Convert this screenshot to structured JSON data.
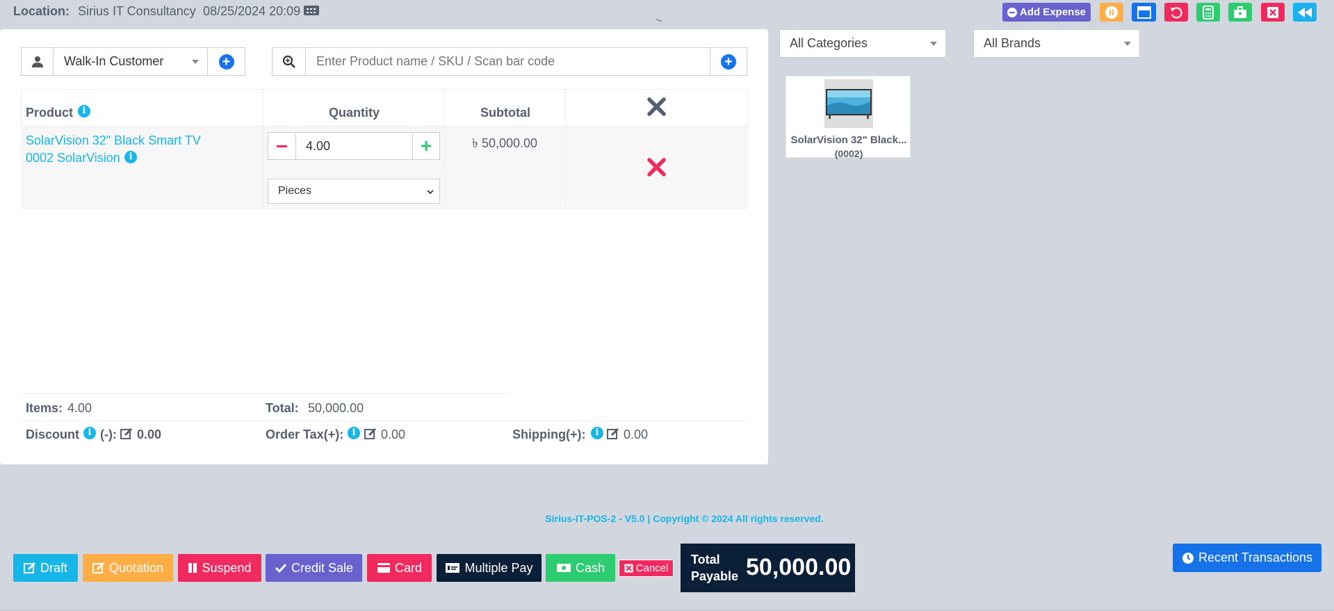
{
  "header": {
    "location_label": "Location:",
    "location_name": "Sirius IT Consultancy",
    "datetime": "08/25/2024 20:09",
    "add_expense_label": "Add Expense"
  },
  "customer": {
    "selected": "Walk-In Customer"
  },
  "search": {
    "placeholder": "Enter Product name / SKU / Scan bar code"
  },
  "table": {
    "headers": {
      "product": "Product",
      "quantity": "Quantity",
      "subtotal": "Subtotal"
    },
    "rows": [
      {
        "product_line1": "SolarVision 32\" Black Smart TV",
        "product_line2": "0002 SolarVision",
        "quantity": "4.00",
        "unit": "Pieces",
        "subtotal": "৳ 50,000.00"
      }
    ]
  },
  "summary": {
    "items_label": "Items:",
    "items_value": "4.00",
    "total_label": "Total:",
    "total_value": "50,000.00",
    "discount_label": "Discount",
    "discount_sign": "(-):",
    "discount_value": "0.00",
    "order_tax_label": "Order Tax(+):",
    "order_tax_value": "0.00",
    "shipping_label": "Shipping(+):",
    "shipping_value": "0.00"
  },
  "filters": {
    "category": "All Categories",
    "brand": "All Brands"
  },
  "products": [
    {
      "name": "SolarVision 32\" Black...",
      "code": "(0002)"
    }
  ],
  "copyright": "Sirius-IT-POS-2 - V5.0 | Copyright © 2024 All rights reserved.",
  "footer": {
    "draft": "Draft",
    "quotation": "Quotation",
    "suspend": "Suspend",
    "credit_sale": "Credit Sale",
    "card": "Card",
    "multiple_pay": "Multiple Pay",
    "cash": "Cash",
    "cancel": "Cancel",
    "total_payable_label_1": "Total",
    "total_payable_label_2": "Payable",
    "total_payable_value": "50,000.00",
    "recent_transactions": "Recent Transactions"
  },
  "colors": {
    "background": "#d2d6de",
    "accent_blue": "#1572e8",
    "info": "#17b6e8",
    "danger": "#f0295f",
    "success": "#2ecc71",
    "warning": "#ffad46",
    "purple": "#6861ce",
    "dark": "#0b2038"
  },
  "icons": {
    "keyboard": "keyboard-icon",
    "user": "user-icon",
    "search": "search-plus-icon",
    "close": "close-icon",
    "remove": "remove-icon",
    "info": "info-icon",
    "edit": "edit-icon",
    "clock": "clock-icon"
  }
}
